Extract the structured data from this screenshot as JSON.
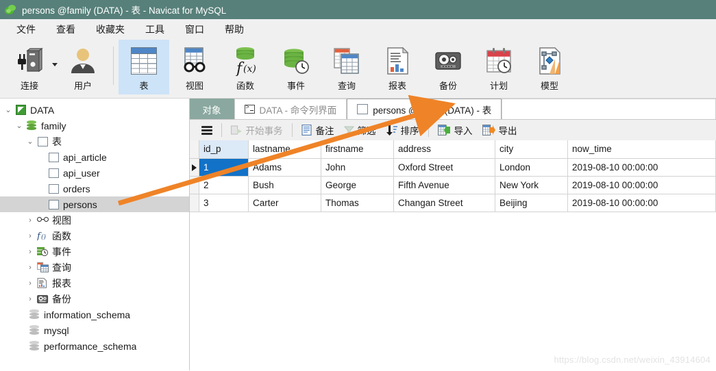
{
  "window": {
    "title": "persons @family (DATA) - 表 - Navicat for MySQL",
    "logo_icon": "navicat-leaf-logo",
    "titlebar_color": "#57807a"
  },
  "menubar": {
    "items": [
      {
        "label": "文件",
        "name": "menu-file"
      },
      {
        "label": "查看",
        "name": "menu-view"
      },
      {
        "label": "收藏夹",
        "name": "menu-favorites"
      },
      {
        "label": "工具",
        "name": "menu-tools"
      },
      {
        "label": "窗口",
        "name": "menu-window"
      },
      {
        "label": "帮助",
        "name": "menu-help"
      }
    ]
  },
  "ribbon": {
    "items": [
      {
        "label": "连接",
        "icon": "connection-plug-icon",
        "selected": false
      },
      {
        "label": "用户",
        "icon": "user-icon",
        "selected": false
      },
      {
        "label": "表",
        "icon": "table-icon",
        "selected": true
      },
      {
        "label": "视图",
        "icon": "view-glasses-icon",
        "selected": false
      },
      {
        "label": "函数",
        "icon": "function-fx-icon",
        "selected": false
      },
      {
        "label": "事件",
        "icon": "event-clock-icon",
        "selected": false
      },
      {
        "label": "查询",
        "icon": "query-icon",
        "selected": false
      },
      {
        "label": "报表",
        "icon": "report-icon",
        "selected": false
      },
      {
        "label": "备份",
        "icon": "backup-tape-icon",
        "selected": false
      },
      {
        "label": "计划",
        "icon": "schedule-calendar-icon",
        "selected": false
      },
      {
        "label": "模型",
        "icon": "model-diagram-icon",
        "selected": false
      }
    ]
  },
  "sidebar": {
    "nodes": [
      {
        "label": "DATA",
        "icon": "connection-icon",
        "indent": 0,
        "twisty": "expanded",
        "selected": false
      },
      {
        "label": "family",
        "icon": "database-icon",
        "indent": 1,
        "twisty": "expanded",
        "selected": false
      },
      {
        "label": "表",
        "icon": "table-icon",
        "indent": 2,
        "twisty": "expanded",
        "selected": false
      },
      {
        "label": "api_article",
        "icon": "table-icon",
        "indent": 3,
        "twisty": "none",
        "selected": false
      },
      {
        "label": "api_user",
        "icon": "table-icon",
        "indent": 3,
        "twisty": "none",
        "selected": false
      },
      {
        "label": "orders",
        "icon": "table-icon",
        "indent": 3,
        "twisty": "none",
        "selected": false
      },
      {
        "label": "persons",
        "icon": "table-icon",
        "indent": 3,
        "twisty": "none",
        "selected": true
      },
      {
        "label": "视图",
        "icon": "view-glasses-icon",
        "indent": 2,
        "twisty": "collapsed",
        "selected": false
      },
      {
        "label": "函数",
        "icon": "function-fx-icon",
        "indent": 2,
        "twisty": "collapsed",
        "selected": false
      },
      {
        "label": "事件",
        "icon": "event-clock-icon",
        "indent": 2,
        "twisty": "collapsed",
        "selected": false
      },
      {
        "label": "查询",
        "icon": "query-icon",
        "indent": 2,
        "twisty": "collapsed",
        "selected": false
      },
      {
        "label": "报表",
        "icon": "report-icon",
        "indent": 2,
        "twisty": "collapsed",
        "selected": false
      },
      {
        "label": "备份",
        "icon": "backup-tape-icon",
        "indent": 2,
        "twisty": "collapsed",
        "selected": false
      },
      {
        "label": "information_schema",
        "icon": "database-gray-icon",
        "indent": 1,
        "twisty": "none",
        "selected": false
      },
      {
        "label": "mysql",
        "icon": "database-gray-icon",
        "indent": 1,
        "twisty": "none",
        "selected": false
      },
      {
        "label": "performance_schema",
        "icon": "database-gray-icon",
        "indent": 1,
        "twisty": "none",
        "selected": false
      }
    ]
  },
  "tabs": [
    {
      "label": "对象",
      "icon": "none",
      "state": "objects"
    },
    {
      "label": "DATA - 命令列界面",
      "icon": "console-icon",
      "state": "inactive"
    },
    {
      "label": "persons @family (DATA) - 表",
      "icon": "table-icon",
      "state": "active"
    }
  ],
  "gridbar": {
    "menu_icon": "hamburger-menu-icon",
    "buttons": [
      {
        "label": "开始事务",
        "icon": "begin-transaction-icon",
        "disabled": true
      },
      {
        "label": "备注",
        "icon": "note-icon",
        "disabled": false
      },
      {
        "label": "筛选",
        "icon": "filter-icon",
        "disabled": true
      },
      {
        "label": "排序",
        "icon": "sort-icon",
        "disabled": false
      },
      {
        "label": "导入",
        "icon": "import-icon",
        "disabled": false
      },
      {
        "label": "导出",
        "icon": "export-icon",
        "disabled": false
      }
    ]
  },
  "grid": {
    "columns": [
      "id_p",
      "lastname",
      "firstname",
      "address",
      "city",
      "now_time"
    ],
    "key_column": "id_p",
    "rows": [
      {
        "id_p": "1",
        "lastname": "Adams",
        "firstname": "John",
        "address": "Oxford Street",
        "city": "London",
        "now_time": "2019-08-10 00:00:00",
        "current": true
      },
      {
        "id_p": "2",
        "lastname": "Bush",
        "firstname": "George",
        "address": "Fifth Avenue",
        "city": "New York",
        "now_time": "2019-08-10 00:00:00",
        "current": false
      },
      {
        "id_p": "3",
        "lastname": "Carter",
        "firstname": "Thomas",
        "address": "Changan Street",
        "city": "Beijing",
        "now_time": "2019-08-10 00:00:00",
        "current": false
      }
    ],
    "selected_cell": {
      "row": 0,
      "column": "id_p"
    }
  },
  "annotation": {
    "arrow_color": "#ef8327",
    "from": "persons-tree-node",
    "to": "active-tab"
  },
  "watermark": {
    "text": "https://blog.csdn.net/weixin_43914604"
  }
}
